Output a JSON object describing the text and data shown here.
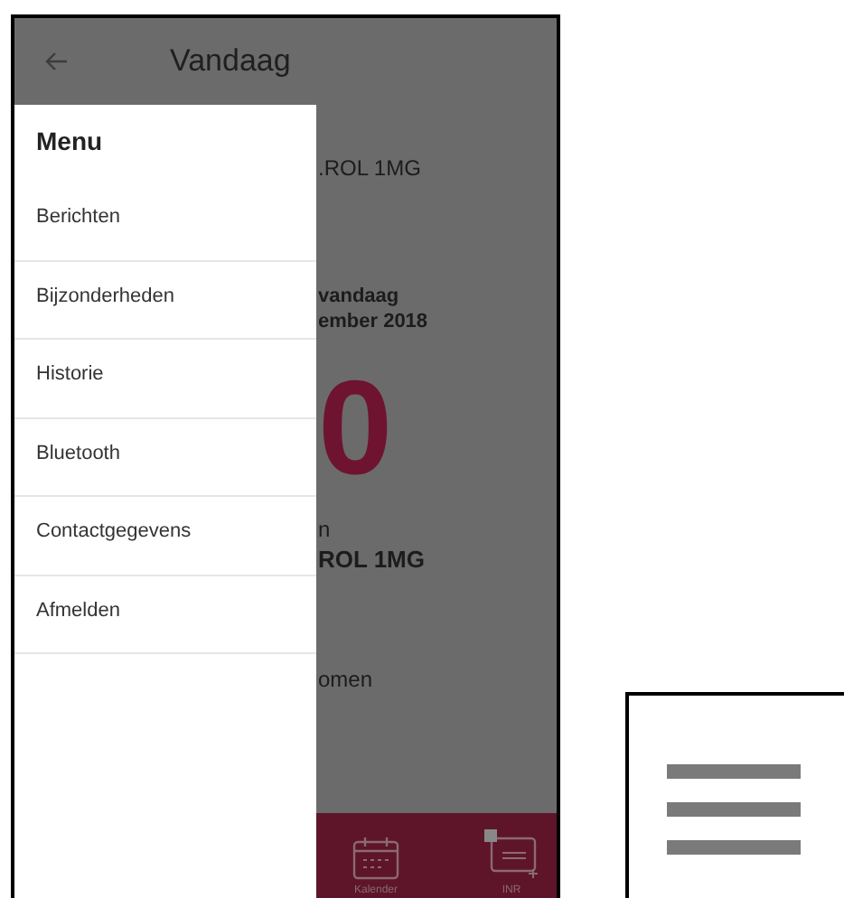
{
  "app_bar": {
    "title": "Vandaag"
  },
  "background": {
    "sections": [
      [
        {
          "text": ".ROL 1MG",
          "kind": "normal"
        }
      ],
      [
        {
          "text": "vandaag",
          "kind": "bold"
        },
        {
          "text": "ember 2018",
          "kind": "bold"
        }
      ],
      [
        {
          "text": "0",
          "kind": "number"
        }
      ],
      [
        {
          "text": "n",
          "kind": "normal"
        },
        {
          "text": "ROL 1MG",
          "kind": "heading"
        }
      ],
      [
        {
          "text": "omen",
          "kind": "normal"
        }
      ]
    ]
  },
  "bottom_nav": [
    {
      "label": "Kalender",
      "kind": "calendar"
    },
    {
      "label": "INR",
      "kind": "inr"
    }
  ],
  "drawer": {
    "title": "Menu",
    "items": [
      {
        "label": "Berichten"
      },
      {
        "label": "Bijzonderheden"
      },
      {
        "label": "Historie"
      },
      {
        "label": "Bluetooth"
      },
      {
        "label": "Contactgegevens"
      },
      {
        "label": "Afmelden"
      }
    ]
  }
}
